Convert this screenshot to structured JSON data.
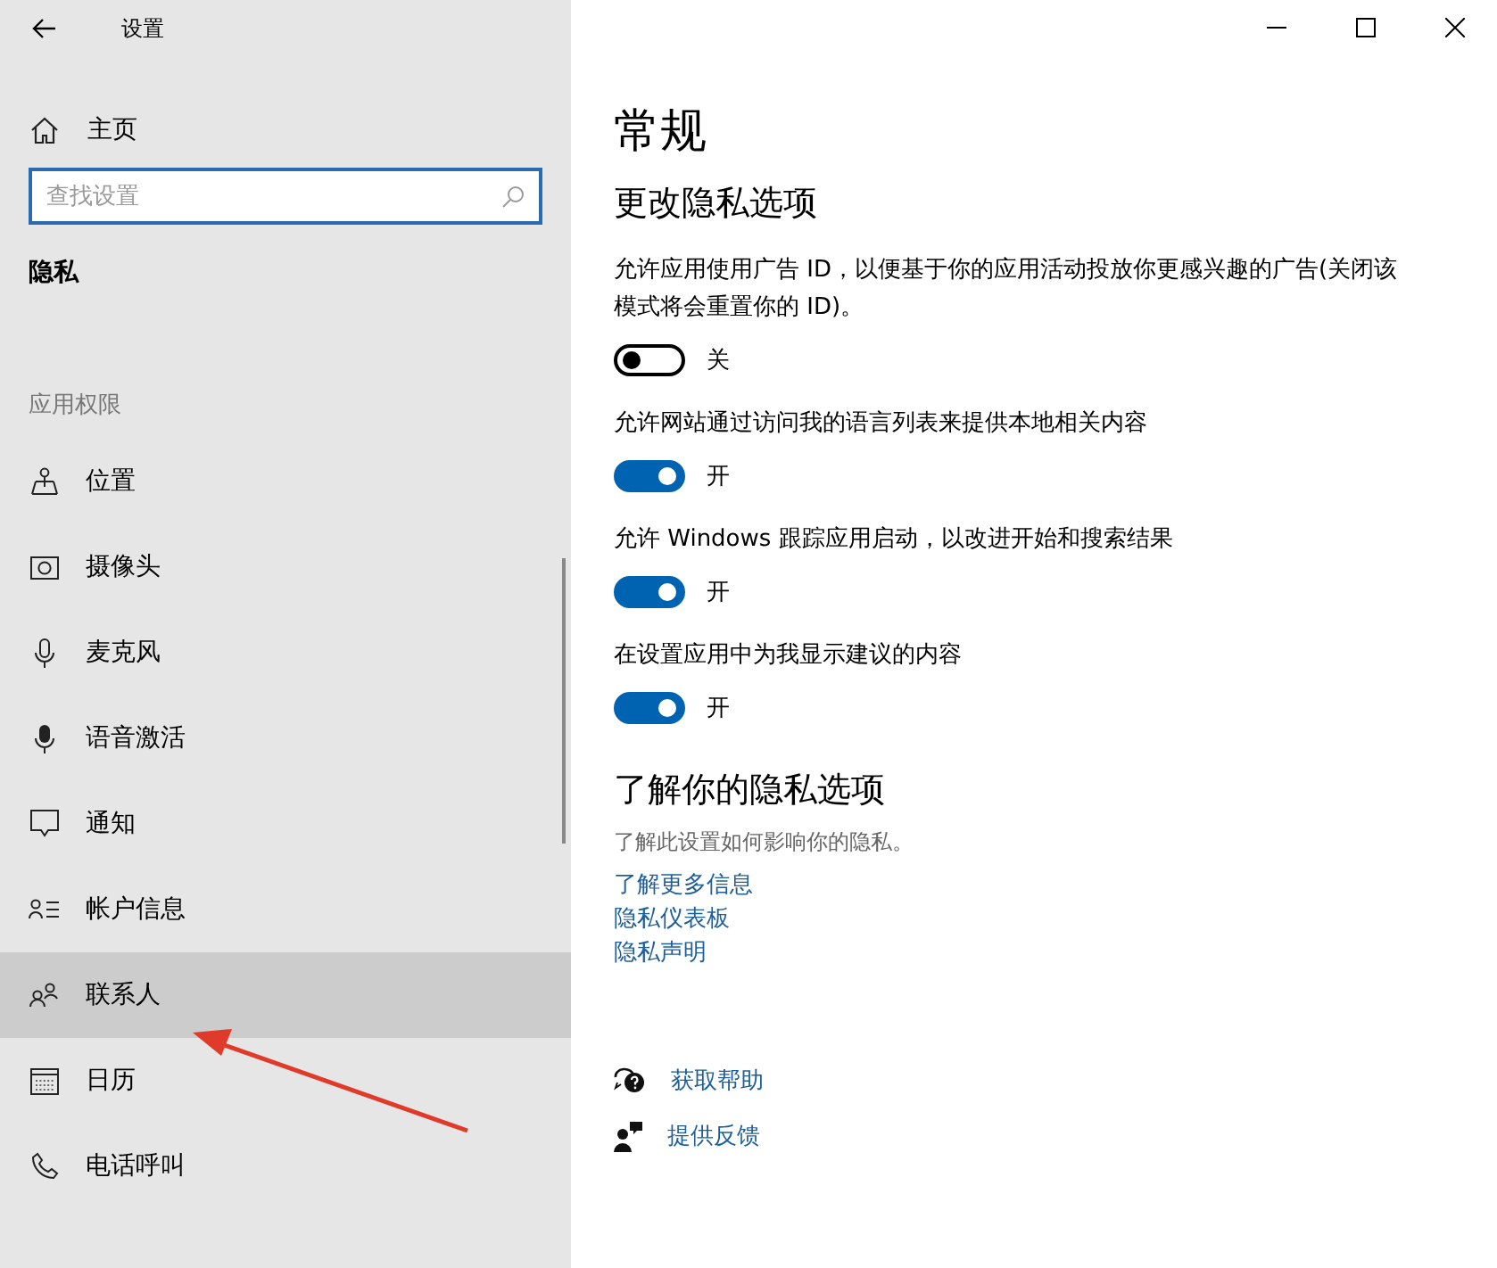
{
  "window": {
    "title": "设置"
  },
  "sidebar": {
    "home": "主页",
    "search": {
      "placeholder": "查找设置"
    },
    "section": "隐私",
    "group": "应用权限",
    "items": [
      {
        "kind": "location",
        "label": "位置",
        "selected": false
      },
      {
        "kind": "camera",
        "label": "摄像头",
        "selected": false
      },
      {
        "kind": "microphone",
        "label": "麦克风",
        "selected": false
      },
      {
        "kind": "voice",
        "label": "语音激活",
        "selected": false
      },
      {
        "kind": "notification",
        "label": "通知",
        "selected": false
      },
      {
        "kind": "account",
        "label": "帐户信息",
        "selected": false
      },
      {
        "kind": "contacts",
        "label": "联系人",
        "selected": true
      },
      {
        "kind": "calendar",
        "label": "日历",
        "selected": false
      },
      {
        "kind": "phone",
        "label": "电话呼叫",
        "selected": false
      }
    ]
  },
  "page": {
    "title": "常规",
    "subtitle": "更改隐私选项",
    "options": [
      {
        "text": "允许应用使用广告 ID，以便基于你的应用活动投放你更感兴趣的广告(关闭该模式将会重置你的 ID)。",
        "on": false,
        "state": "关"
      },
      {
        "text": "允许网站通过访问我的语言列表来提供本地相关内容",
        "on": true,
        "state": "开"
      },
      {
        "text": "允许 Windows 跟踪应用启动，以改进开始和搜索结果",
        "on": true,
        "state": "开"
      },
      {
        "text": "在设置应用中为我显示建议的内容",
        "on": true,
        "state": "开"
      }
    ],
    "learn": {
      "title": "了解你的隐私选项",
      "text": "了解此设置如何影响你的隐私。",
      "links": [
        "了解更多信息",
        "隐私仪表板",
        "隐私声明"
      ]
    },
    "help": [
      {
        "kind": "help",
        "label": "获取帮助"
      },
      {
        "kind": "feedback",
        "label": "提供反馈"
      }
    ]
  }
}
